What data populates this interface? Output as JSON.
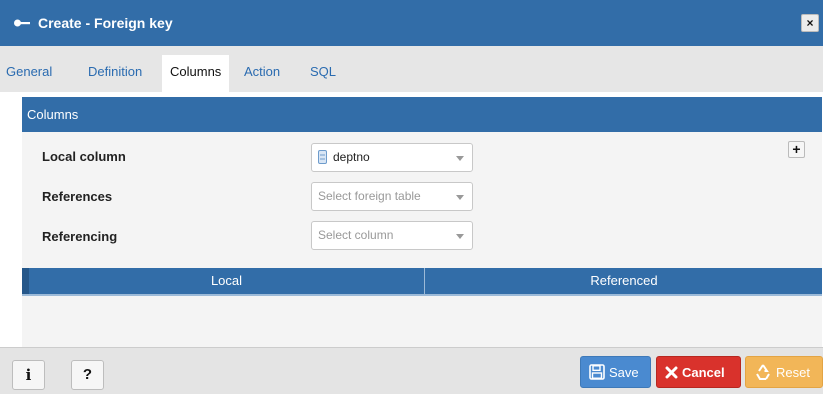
{
  "dialog": {
    "title": "Create - Foreign key",
    "close_label": "×"
  },
  "tabs": [
    {
      "label": "General",
      "active": false
    },
    {
      "label": "Definition",
      "active": false
    },
    {
      "label": "Columns",
      "active": true
    },
    {
      "label": "Action",
      "active": false
    },
    {
      "label": "SQL",
      "active": false
    }
  ],
  "columns_panel": {
    "header": "Columns",
    "add_label": "+",
    "fields": {
      "local_column": {
        "label": "Local column",
        "value": "deptno"
      },
      "references": {
        "label": "References",
        "placeholder": "Select foreign table"
      },
      "referencing": {
        "label": "Referencing",
        "placeholder": "Select column"
      }
    },
    "grid": {
      "columns": [
        "Local",
        "Referenced"
      ]
    }
  },
  "footer": {
    "info_label": "i",
    "help_label": "?",
    "save_label": "Save",
    "cancel_label": "Cancel",
    "reset_label": "Reset"
  },
  "colors": {
    "header_blue": "#326da8",
    "save": "#4a8ad0",
    "cancel": "#d9322c",
    "reset": "#f2b658"
  },
  "icons": {
    "title": "key-icon",
    "column": "column-icon",
    "save": "floppy-disk-icon",
    "cancel": "x-icon",
    "reset": "recycle-icon"
  }
}
